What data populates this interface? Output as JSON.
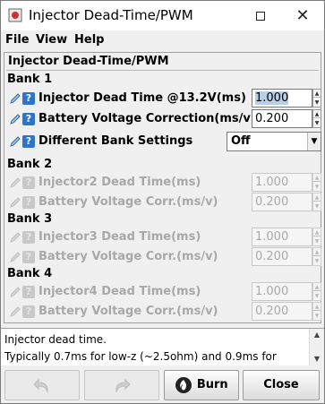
{
  "window": {
    "title": "Injector Dead-Time/PWM",
    "controls": {
      "restore": "restore",
      "close": "✕"
    }
  },
  "menu": {
    "file": "File",
    "view": "View",
    "help": "Help"
  },
  "panel": {
    "title": "Injector Dead-Time/PWM",
    "banks": [
      {
        "title": "Bank 1",
        "rows": [
          {
            "label": "Injector Dead Time @13.2V(ms)",
            "value": "1.000",
            "enabled": true
          },
          {
            "label": "Battery Voltage Correction(ms/v)",
            "value": "0.200",
            "enabled": true
          },
          {
            "label": "Different Bank Settings",
            "value": "Off",
            "enabled": true,
            "type": "select"
          }
        ]
      },
      {
        "title": "Bank 2",
        "rows": [
          {
            "label": "Injector2 Dead Time(ms)",
            "value": "1.000",
            "enabled": false
          },
          {
            "label": "Battery Voltage Corr.(ms/v)",
            "value": "0.200",
            "enabled": false
          }
        ]
      },
      {
        "title": "Bank 3",
        "rows": [
          {
            "label": "Injector3 Dead Time(ms)",
            "value": "1.000",
            "enabled": false
          },
          {
            "label": "Battery Voltage Corr.(ms/v)",
            "value": "0.200",
            "enabled": false
          }
        ]
      },
      {
        "title": "Bank 4",
        "rows": [
          {
            "label": "Injector4 Dead Time(ms)",
            "value": "1.000",
            "enabled": false
          },
          {
            "label": "Battery Voltage Corr.(ms/v)",
            "value": "0.200",
            "enabled": false
          }
        ]
      }
    ]
  },
  "help_text": {
    "line1": "Injector dead time.",
    "line2": "Typically 0.7ms for low-z (~2.5ohm) and 0.9ms for"
  },
  "buttons": {
    "undo": "",
    "redo": "",
    "burn": "Burn",
    "close": "Close"
  },
  "colors": {
    "help_icon": "#2f74c9",
    "selection": "#b8cfe5",
    "disabled_text": "#a8a8a8"
  }
}
